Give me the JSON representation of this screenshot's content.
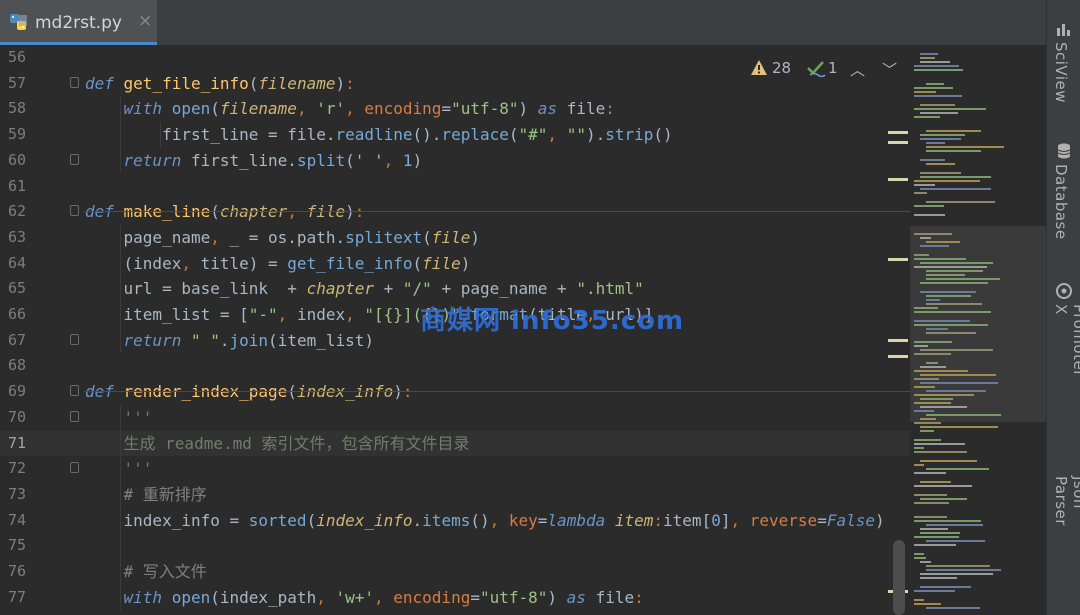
{
  "tab": {
    "title": "md2rst.py",
    "close": "×",
    "icon": "python-file-icon"
  },
  "inspections": {
    "warnings": "28",
    "typos": "1",
    "warning_icon": "warning-icon",
    "check_icon": "check-icon"
  },
  "watermark": "商媒网 info35.com",
  "side_tools": [
    "SciView",
    "Database",
    "Key Promoter X",
    "Json Parser"
  ],
  "lines": [
    {
      "num": "56",
      "tokens": []
    },
    {
      "num": "57",
      "fold": true,
      "tokens": [
        [
          "kw",
          "def "
        ],
        [
          "fn",
          "get_file_info"
        ],
        [
          "",
          "("
        ],
        [
          "param",
          "filename"
        ],
        [
          "",
          ")"
        ],
        [
          "op",
          ":"
        ]
      ]
    },
    {
      "num": "58",
      "tokens": [
        [
          "",
          "    "
        ],
        [
          "kw",
          "with "
        ],
        [
          "bi",
          "open"
        ],
        [
          "",
          "("
        ],
        [
          "param",
          "filename"
        ],
        [
          "op",
          ", "
        ],
        [
          "str",
          "'r'"
        ],
        [
          "op",
          ", "
        ],
        [
          "kwarg",
          "encoding"
        ],
        [
          "",
          "="
        ],
        [
          "str",
          "\"utf-8\""
        ],
        [
          "",
          ") "
        ],
        [
          "kw",
          "as "
        ],
        [
          "",
          "file"
        ],
        [
          "op",
          ":"
        ]
      ]
    },
    {
      "num": "59",
      "tokens": [
        [
          "",
          "        first_line "
        ],
        [
          "",
          "= "
        ],
        [
          "",
          "file."
        ],
        [
          "meth",
          "readline"
        ],
        [
          "",
          "()."
        ],
        [
          "meth",
          "replace"
        ],
        [
          "",
          "("
        ],
        [
          "str",
          "\"#\""
        ],
        [
          "op",
          ", "
        ],
        [
          "str",
          "\"\""
        ],
        [
          "",
          ")."
        ],
        [
          "meth",
          "strip"
        ],
        [
          "",
          "()"
        ]
      ]
    },
    {
      "num": "60",
      "fold": true,
      "tokens": [
        [
          "",
          "    "
        ],
        [
          "kw",
          "return "
        ],
        [
          "",
          "first_line."
        ],
        [
          "meth",
          "split"
        ],
        [
          "",
          "("
        ],
        [
          "str",
          "' '"
        ],
        [
          "op",
          ", "
        ],
        [
          "num",
          "1"
        ],
        [
          "",
          ")"
        ]
      ]
    },
    {
      "num": "61",
      "tokens": []
    },
    {
      "num": "62",
      "fold": true,
      "tokens": [
        [
          "kw",
          "def "
        ],
        [
          "fn",
          "make_line"
        ],
        [
          "",
          "("
        ],
        [
          "param",
          "chapter"
        ],
        [
          "op",
          ", "
        ],
        [
          "param",
          "file"
        ],
        [
          "",
          ")"
        ],
        [
          "op",
          ":"
        ]
      ]
    },
    {
      "num": "63",
      "tokens": [
        [
          "",
          "    page_name"
        ],
        [
          "op",
          ", "
        ],
        [
          "",
          "_ = os.path."
        ],
        [
          "meth",
          "splitext"
        ],
        [
          "",
          "("
        ],
        [
          "param",
          "file"
        ],
        [
          "",
          ")"
        ]
      ]
    },
    {
      "num": "64",
      "tokens": [
        [
          "",
          "    (index"
        ],
        [
          "op",
          ", "
        ],
        [
          "",
          "title) = "
        ],
        [
          "meth",
          "get_file_info"
        ],
        [
          "",
          "("
        ],
        [
          "param",
          "file"
        ],
        [
          "",
          ")"
        ]
      ]
    },
    {
      "num": "65",
      "tokens": [
        [
          "",
          "    url = base_link  + "
        ],
        [
          "param",
          "chapter"
        ],
        [
          "",
          " + "
        ],
        [
          "str",
          "\"/\""
        ],
        [
          "",
          " + page_name + "
        ],
        [
          "str",
          "\".html\""
        ]
      ]
    },
    {
      "num": "66",
      "tokens": [
        [
          "",
          "    item_list = ["
        ],
        [
          "str",
          "\"-\""
        ],
        [
          "op",
          ", "
        ],
        [
          "",
          "index"
        ],
        [
          "op",
          ", "
        ],
        [
          "str",
          "\"[{}]({})\""
        ],
        [
          "",
          "."
        ],
        [
          "meth",
          "format"
        ],
        [
          "",
          "(title"
        ],
        [
          "op",
          ", "
        ],
        [
          "",
          "url)]"
        ]
      ]
    },
    {
      "num": "67",
      "fold": true,
      "tokens": [
        [
          "",
          "    "
        ],
        [
          "kw",
          "return "
        ],
        [
          "str",
          "\" \""
        ],
        [
          "",
          "."
        ],
        [
          "meth",
          "join"
        ],
        [
          "",
          "(item_list)"
        ]
      ]
    },
    {
      "num": "68",
      "tokens": []
    },
    {
      "num": "69",
      "fold": true,
      "tokens": [
        [
          "kw",
          "def "
        ],
        [
          "fn",
          "render_index_page"
        ],
        [
          "",
          "("
        ],
        [
          "param",
          "index_info"
        ],
        [
          "",
          ")"
        ],
        [
          "op",
          ":"
        ]
      ]
    },
    {
      "num": "70",
      "fold": true,
      "tokens": [
        [
          "",
          "    "
        ],
        [
          "doc",
          "'''"
        ]
      ]
    },
    {
      "num": "71",
      "current": true,
      "tokens": [
        [
          "",
          "    "
        ],
        [
          "doc",
          "生成 readme.md 索引文件，包含所有文件目录"
        ]
      ]
    },
    {
      "num": "72",
      "fold": true,
      "tokens": [
        [
          "",
          "    "
        ],
        [
          "doc",
          "'''"
        ]
      ]
    },
    {
      "num": "73",
      "tokens": [
        [
          "",
          "    "
        ],
        [
          "cmt",
          "# 重新排序"
        ]
      ]
    },
    {
      "num": "74",
      "tokens": [
        [
          "",
          "    index_info = "
        ],
        [
          "bi",
          "sorted"
        ],
        [
          "",
          "("
        ],
        [
          "param",
          "index_info"
        ],
        [
          "",
          "."
        ],
        [
          "meth",
          "items"
        ],
        [
          "",
          "()"
        ],
        [
          "op",
          ", "
        ],
        [
          "kwarg",
          "key"
        ],
        [
          "",
          "="
        ],
        [
          "kw",
          "lambda "
        ],
        [
          "param",
          "item"
        ],
        [
          "op",
          ":"
        ],
        [
          "",
          "item["
        ],
        [
          "num",
          "0"
        ],
        [
          "",
          "]"
        ],
        [
          "op",
          ", "
        ],
        [
          "kwarg",
          "reverse"
        ],
        [
          "",
          "="
        ],
        [
          "kfalse",
          "False"
        ],
        [
          "",
          ")"
        ]
      ]
    },
    {
      "num": "75",
      "tokens": []
    },
    {
      "num": "76",
      "tokens": [
        [
          "",
          "    "
        ],
        [
          "cmt",
          "# 写入文件"
        ]
      ]
    },
    {
      "num": "77",
      "tokens": [
        [
          "",
          "    "
        ],
        [
          "kw",
          "with "
        ],
        [
          "bi",
          "open"
        ],
        [
          "",
          "(index_path"
        ],
        [
          "op",
          ", "
        ],
        [
          "str",
          "'w+'"
        ],
        [
          "op",
          ", "
        ],
        [
          "kwarg",
          "encoding"
        ],
        [
          "",
          "="
        ],
        [
          "str",
          "\"utf-8\""
        ],
        [
          "",
          ") "
        ],
        [
          "kw",
          "as "
        ],
        [
          "",
          "file"
        ],
        [
          "op",
          ":"
        ]
      ]
    }
  ]
}
